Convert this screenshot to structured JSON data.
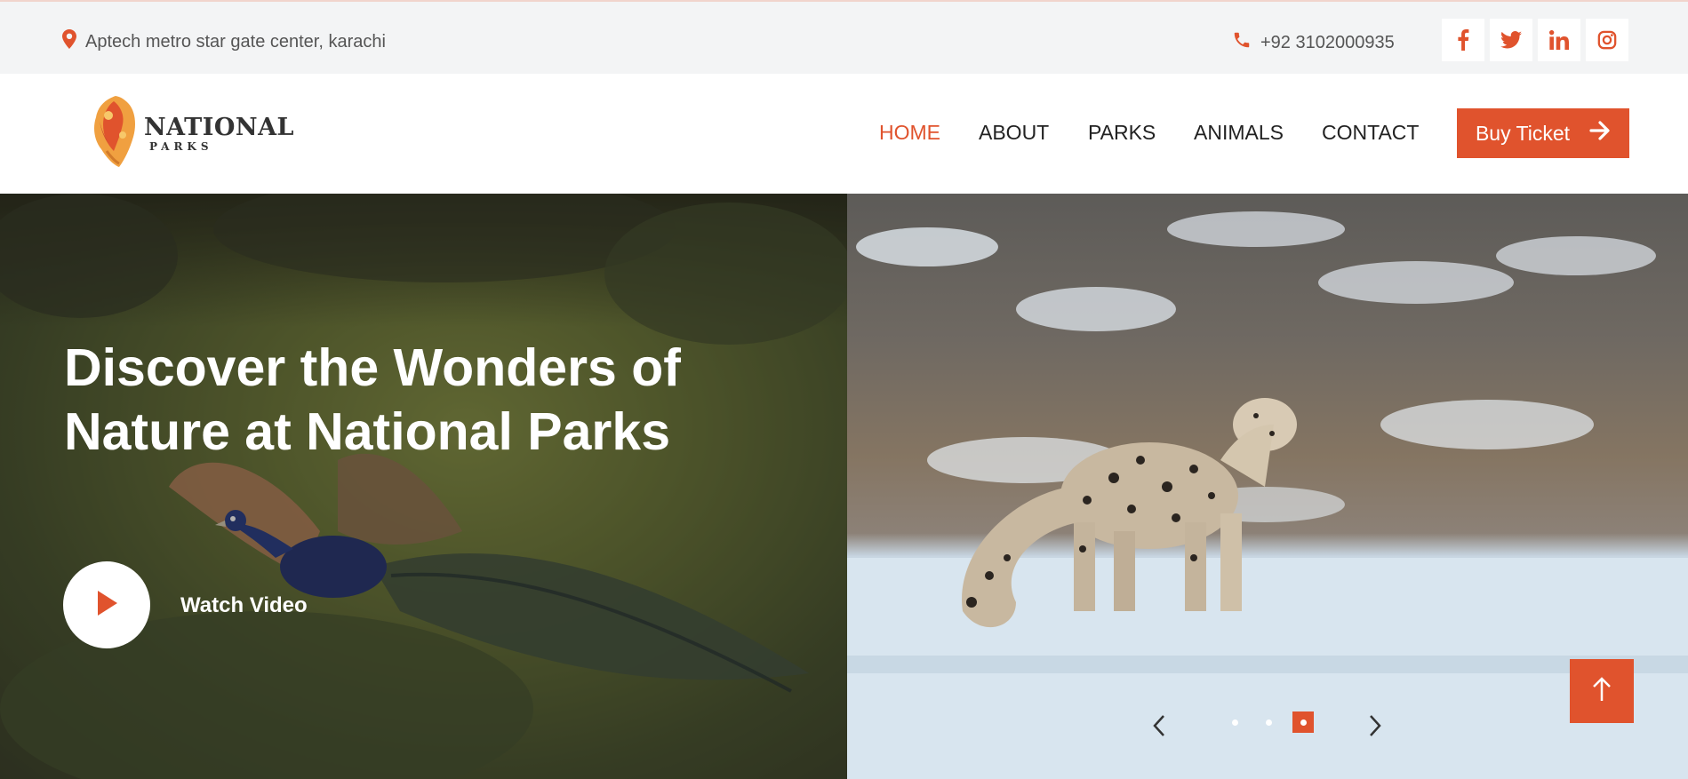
{
  "topbar": {
    "location": "Aptech metro star gate center, karachi",
    "location_icon": "map-pin-icon",
    "phone": "+92 3102000935",
    "phone_icon": "phone-icon",
    "socials": [
      {
        "icon": "facebook-icon",
        "glyph": "f"
      },
      {
        "icon": "twitter-icon",
        "glyph": "t"
      },
      {
        "icon": "linkedin-icon",
        "glyph": "in"
      },
      {
        "icon": "instagram-icon",
        "glyph": "ig"
      }
    ]
  },
  "logo": {
    "main": "NATIONAL",
    "sub": "PARKS"
  },
  "nav": {
    "items": [
      "HOME",
      "ABOUT",
      "PARKS",
      "ANIMALS",
      "CONTACT"
    ],
    "active": "HOME",
    "buy_label": "Buy Ticket"
  },
  "hero": {
    "headline": "Discover the Wonders of Nature at National Parks",
    "watch_label": "Watch Video",
    "slides_count": 3,
    "active_slide": 3
  },
  "colors": {
    "accent": "#e0532d",
    "topbar_bg": "#f3f4f5"
  }
}
